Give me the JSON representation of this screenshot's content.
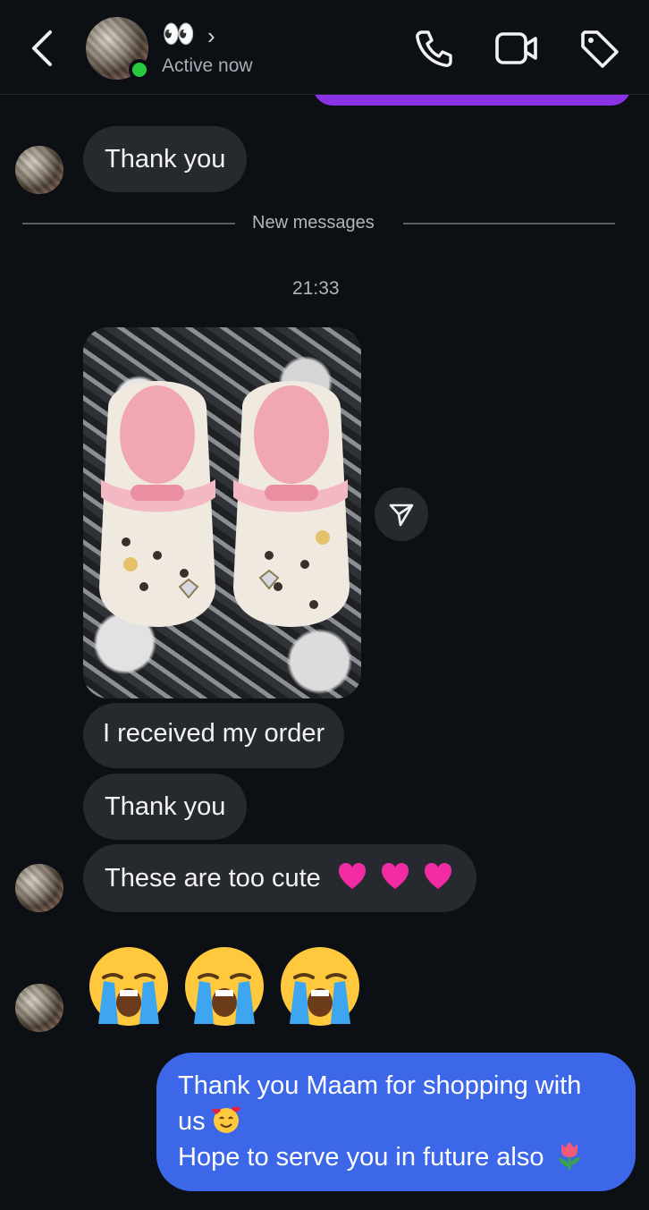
{
  "header": {
    "contact_name": "👀",
    "status": "Active now",
    "back_icon": "chevron-left-icon",
    "call_icon": "phone-icon",
    "video_icon": "video-camera-icon",
    "tag_icon": "tag-icon"
  },
  "messages": {
    "thank_you_1": "Thank you",
    "divider_label": "New messages",
    "timestamp": "21:33",
    "received_order": "I received my order",
    "thank_you_2": "Thank you",
    "too_cute": "These are too cute",
    "cute_emojis": [
      "pink-heart",
      "pink-heart",
      "pink-heart"
    ],
    "crying_emojis": [
      "loudly-crying-face",
      "loudly-crying-face",
      "loudly-crying-face"
    ],
    "reply_line1": "Thank you Maam for shopping with",
    "reply_line2": "us",
    "reply_line2_emoji": "smiling-face-with-hearts",
    "reply_line3": "Hope to serve you in future also",
    "reply_line3_emoji": "tulip"
  },
  "colors": {
    "background": "#0c0f14",
    "incoming_bubble": "#26292e",
    "outgoing_bubble": "#3b67e8",
    "previous_outgoing": "#8b32e6",
    "online": "#27c93f"
  }
}
